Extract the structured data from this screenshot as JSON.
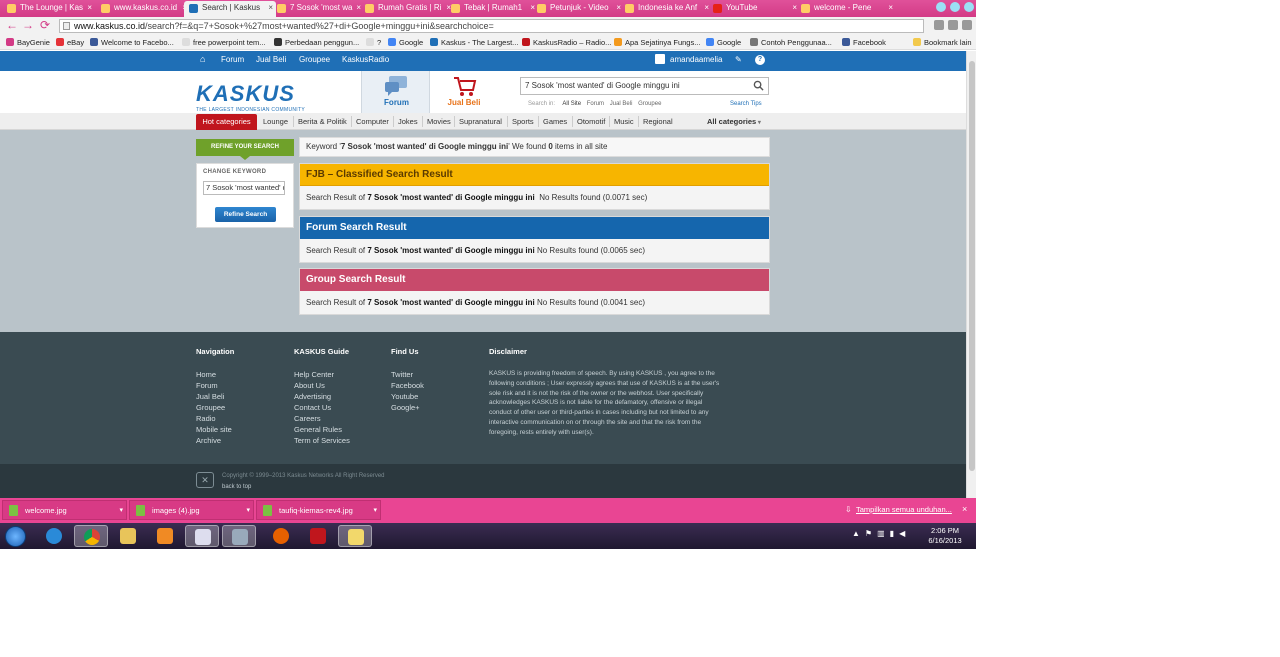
{
  "browser": {
    "tabs": [
      {
        "label": "The Lounge | Kas",
        "active": false
      },
      {
        "label": "www.kaskus.co.id",
        "active": false
      },
      {
        "label": "Search | Kaskus",
        "active": true
      },
      {
        "label": "7 Sosok 'most wa",
        "active": false
      },
      {
        "label": "Rumah Gratis | Ri",
        "active": false
      },
      {
        "label": "Tebak | Rumah1",
        "active": false
      },
      {
        "label": "Petunjuk - Video",
        "active": false
      },
      {
        "label": "Indonesia ke Anf",
        "active": false
      },
      {
        "label": "YouTube",
        "active": false
      },
      {
        "label": "welcome - Pene",
        "active": false
      }
    ],
    "url_host": "www.kaskus.co.id",
    "url_path": "/search?f=&q=7+Sosok+%27most+wanted%27+di+Google+minggu+ini&searchchoice=",
    "bookmarks": [
      "BayGenie",
      "eBay",
      "Welcome to Facebo...",
      "free powerpoint tem...",
      "Perbedaan penggun...",
      "?",
      "Google",
      "Kaskus - The Largest...",
      "KaskusRadio – Radio...",
      "Apa Sejatinya Fungs...",
      "Google",
      "Contoh Penggunaa...",
      "Facebook"
    ],
    "other_bookmarks": "Bookmark lain"
  },
  "kaskus": {
    "topnav": [
      "Forum",
      "Jual Beli",
      "Groupee",
      "KaskusRadio"
    ],
    "username": "amandaamelia",
    "logo_text": "KASKUS",
    "logo_tagline": "THE LARGEST INDONESIAN COMMUNITY",
    "tab_forum": "Forum",
    "tab_jualbeli": "Jual Beli",
    "search_value": "7 Sosok 'most wanted' di Google minggu ini",
    "search_in_label": "Search in:",
    "search_in_options": [
      "All Site",
      "Forum",
      "Jual Beli",
      "Groupee"
    ],
    "search_tips": "Search Tips",
    "hot_categories": "Hot categories",
    "categories": [
      "Lounge",
      "Berita & Politik",
      "Computer",
      "Jokes",
      "Movies",
      "Supranatural",
      "Sports",
      "Games",
      "Otomotif",
      "Music",
      "Regional"
    ],
    "all_categories": "All categories"
  },
  "results": {
    "refine_tab": "REFINE YOUR SEARCH",
    "keyword_prefix": "Keyword '",
    "keyword": "7 Sosok 'most wanted' di Google minggu ini",
    "keyword_mid": "' We found ",
    "found_count": "0",
    "keyword_suffix": " items in all site",
    "change_keyword_label": "CHANGE KEYWORD",
    "refine_input_value": "7 Sosok 'most wanted' di Google minggu ini",
    "refine_button": "Refine Search",
    "result_prefix": "Search Result of ",
    "sections": [
      {
        "title": "FJB – Classified Search Result",
        "status": "No Results found (0.0071 sec)"
      },
      {
        "title": "Forum Search Result",
        "status": "No Results found (0.0065 sec)"
      },
      {
        "title": "Group Search Result",
        "status": "No Results found (0.0041 sec)"
      }
    ]
  },
  "footer": {
    "navigation": {
      "title": "Navigation",
      "links": [
        "Home",
        "Forum",
        "Jual Beli",
        "Groupee",
        "Radio",
        "Mobile site",
        "Archive"
      ]
    },
    "guide": {
      "title": "KASKUS Guide",
      "links": [
        "Help Center",
        "About Us",
        "Advertising",
        "Contact Us",
        "Careers",
        "General Rules",
        "Term of Services"
      ]
    },
    "findus": {
      "title": "Find Us",
      "links": [
        "Twitter",
        "Facebook",
        "Youtube",
        "Google+"
      ]
    },
    "disclaimer_title": "Disclaimer",
    "disclaimer_text": "KASKUS is providing freedom of speech. By using KASKUS , you agree to the following conditions ; User expressly agrees that use of KASKUS is at the user's sole risk and it is not the risk of the owner or the webhost. User specifically acknowledges KASKUS is not liable for the defamatory, offensive or illegal conduct of other user or third-parties in cases including but not limited to any interactive communication on or through the site and that the risk from the foregoing, rests entirely with user(s).",
    "copyright": "Copyright © 1999–2013 Kaskus Networks All Right Reserved",
    "back_to_top": "back to top"
  },
  "downloads": {
    "items": [
      "welcome.jpg",
      "images (4).jpg",
      "taufiq-kiemas-rev4.jpg"
    ],
    "show_all": "Tampilkan semua unduhan..."
  },
  "taskbar": {
    "time": "2:06 PM",
    "date": "6/16/2013"
  },
  "colors": {
    "chrome_pink": "#e0519a",
    "kaskus_blue": "#1f6fb6",
    "hot_red": "#c0161d",
    "fjb_yellow": "#f7b500",
    "forum_blue": "#1566ad",
    "group_pink": "#c84a6b",
    "refine_green": "#6fa12a",
    "footer_dark": "#3a4b52"
  }
}
